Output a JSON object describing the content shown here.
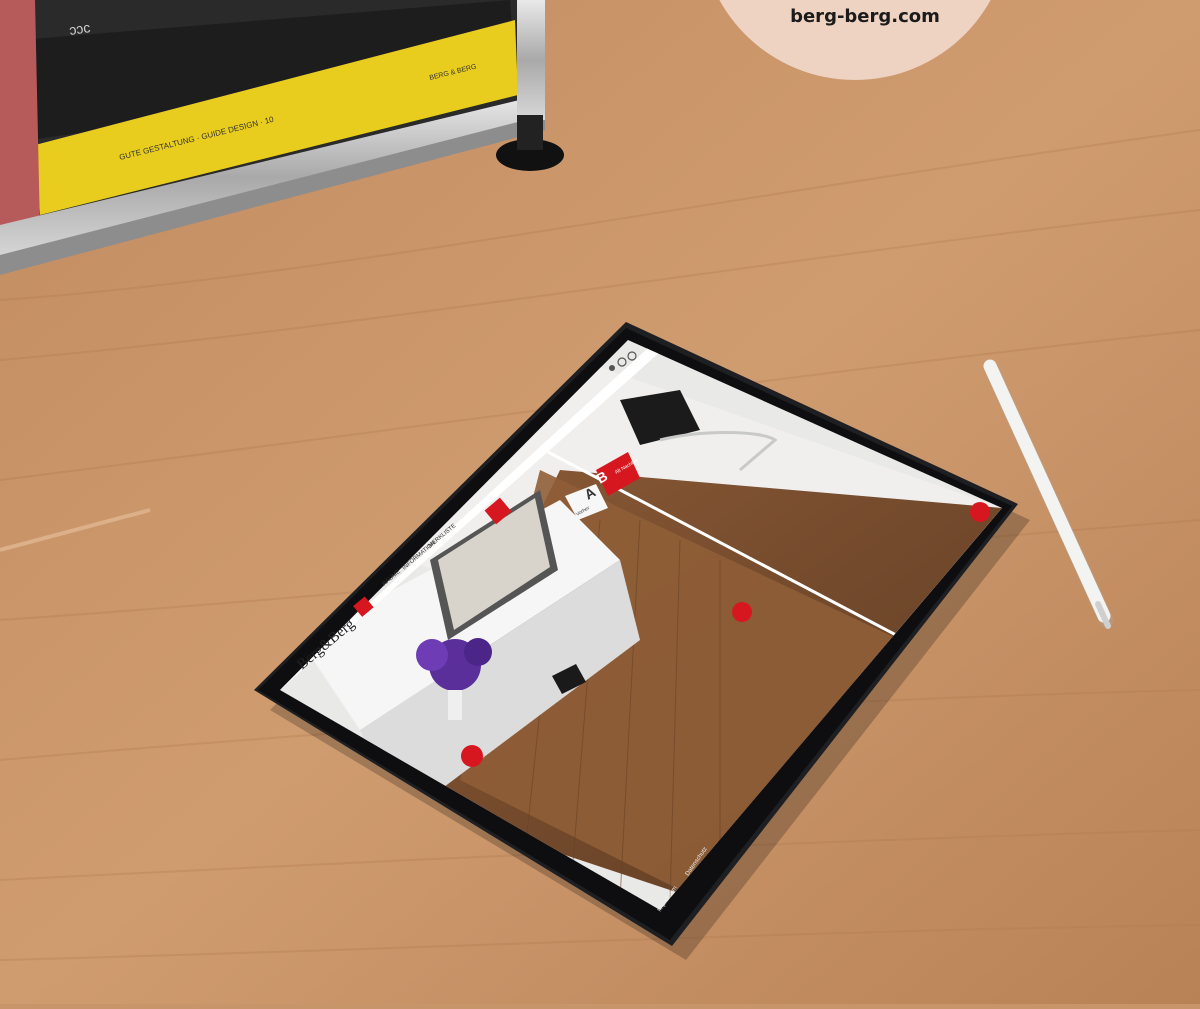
{
  "badge": {
    "url": "berg-berg.com"
  },
  "shelf": {
    "binder_spine": "GUTE GESTALTUNG · GUIDE DESIGN · 10",
    "binder_label": "BERG & BERG"
  },
  "app": {
    "logo": "Berg&Berg",
    "nav_items": [
      "RÄUME",
      "INFORMATION",
      "MERKLISTE"
    ],
    "compare": {
      "a_letter": "A",
      "a_label": "Vorher",
      "b_letter": "B",
      "b_label": "Alt Nachher"
    },
    "footer": [
      "Impressum",
      "Datenschutz"
    ]
  },
  "colors": {
    "brand_red": "#d7171f",
    "badge": "#eed3c3",
    "wood": "#c8946a"
  }
}
